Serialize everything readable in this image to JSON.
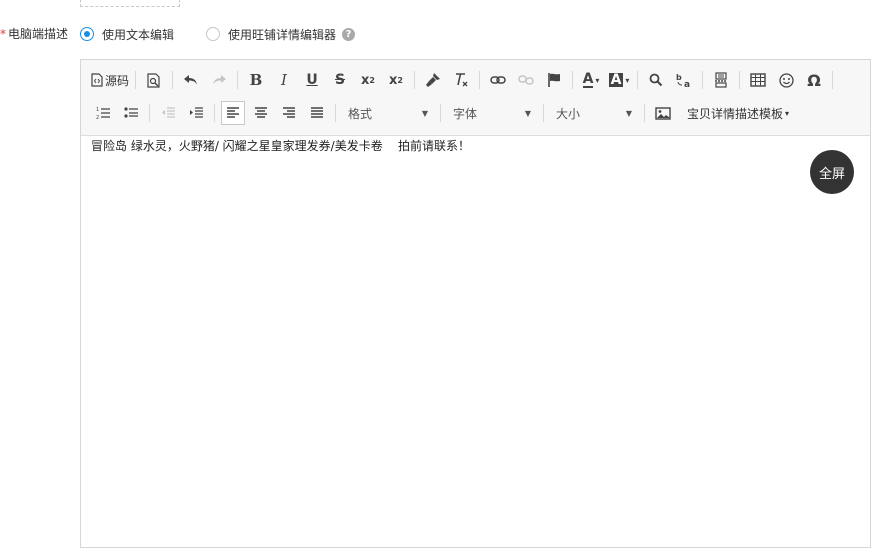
{
  "field": {
    "required_mark": "*",
    "label": "电脑端描述"
  },
  "options": {
    "text_editor": {
      "label": "使用文本编辑",
      "selected": true
    },
    "wangpu_editor": {
      "label": "使用旺铺详情编辑器",
      "selected": false
    },
    "help": "?"
  },
  "toolbar": {
    "source_label": "源码",
    "format_label": "格式",
    "font_label": "字体",
    "size_label": "大小",
    "template_label": "宝贝详情描述模板",
    "bold": "B",
    "italic": "I",
    "underline": "U",
    "strike": "S",
    "subscript": "x",
    "subscript_small": "2",
    "superscript": "x",
    "superscript_small": "2",
    "font_color": "A",
    "bg_color": "A",
    "special_char": "Ω"
  },
  "editor": {
    "content": "冒险岛 绿水灵，火野猪/ 闪耀之星皇家理发券/美发卡卷    拍前请联系！",
    "fullscreen_label": "全屏"
  },
  "colors": {
    "accent": "#1d8fe1",
    "required": "#e4393c",
    "toolbar_bg": "#f7f7f7",
    "fullscreen_bg": "#333333"
  }
}
